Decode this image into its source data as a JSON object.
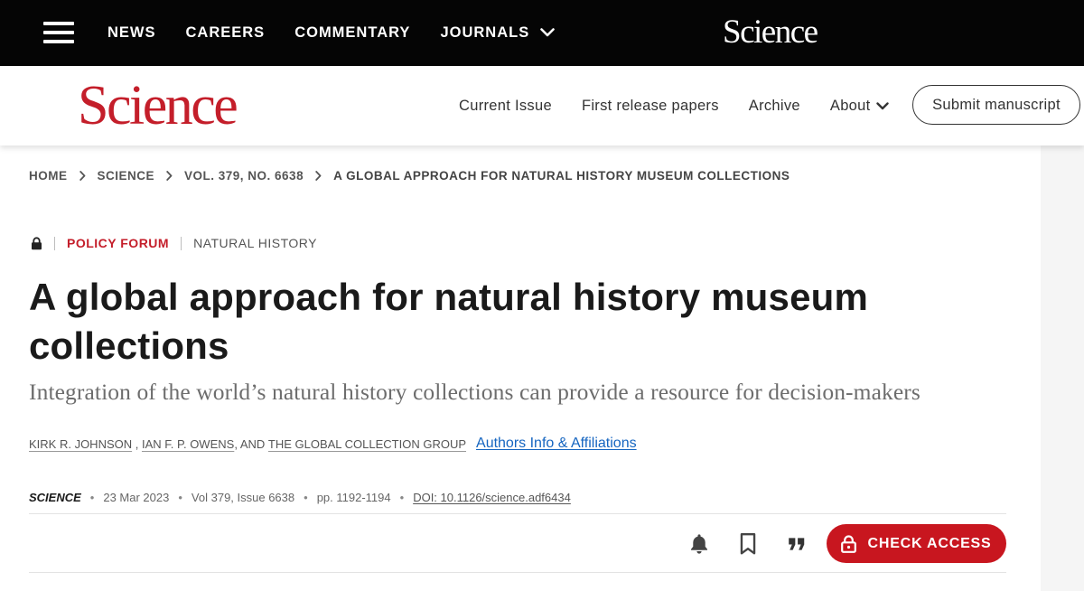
{
  "topbar": {
    "nav": [
      "NEWS",
      "CAREERS",
      "COMMENTARY",
      "JOURNALS"
    ],
    "logo": "Science"
  },
  "header": {
    "logo": "Science",
    "nav": [
      "Current Issue",
      "First release papers",
      "Archive",
      "About"
    ],
    "submit_label": "Submit manuscript"
  },
  "breadcrumb": [
    "HOME",
    "SCIENCE",
    "VOL. 379, NO. 6638",
    "A GLOBAL APPROACH FOR NATURAL HISTORY MUSEUM COLLECTIONS"
  ],
  "article": {
    "category": "POLICY FORUM",
    "topic": "NATURAL HISTORY",
    "title": "A global approach for natural history museum collections",
    "subtitle": "Integration of the world’s natural history collections can provide a resource for decision-makers",
    "authors": [
      "KIRK R. JOHNSON",
      "IAN F. P. OWENS",
      "THE GLOBAL COLLECTION GROUP"
    ],
    "author_sep_1": " , ",
    "author_sep_2": ", AND ",
    "affiliations_link": "Authors Info & Affiliations",
    "journal": "SCIENCE",
    "date": "23 Mar 2023",
    "volume": "Vol 379, Issue 6638",
    "pages": "pp. 1192-1194",
    "doi": "DOI: 10.1126/science.adf6434",
    "dot": "•"
  },
  "actions": {
    "check_access": "CHECK ACCESS",
    "icons": [
      "bell-icon",
      "bookmark-icon",
      "quote-icon",
      "lock-icon"
    ]
  },
  "colors": {
    "brand_red": "#c41e2a",
    "button_red": "#c8161f",
    "link_blue": "#1565c0",
    "topbar_bg": "#050505"
  }
}
